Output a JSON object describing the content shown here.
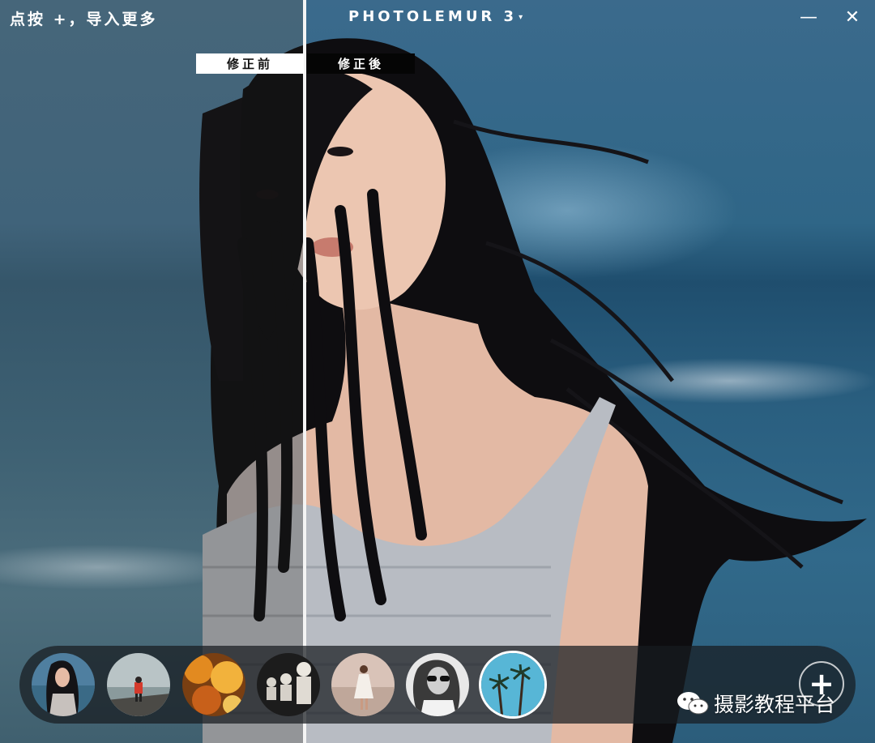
{
  "window": {
    "title": "PHOTOLEMUR 3",
    "title_caret": "▾",
    "import_hint": "点按 +，导入更多",
    "minimize_glyph": "—",
    "close_glyph": "✕"
  },
  "compare": {
    "before_label": "修正前",
    "after_label": "修正後",
    "split_position": 0.348
  },
  "thumbnails": [
    {
      "name": "woman-beach-portrait",
      "selected": false
    },
    {
      "name": "person-red-jacket-dock",
      "selected": false
    },
    {
      "name": "autumn-leaves",
      "selected": false
    },
    {
      "name": "statues",
      "selected": false
    },
    {
      "name": "woman-dancing-beach",
      "selected": false
    },
    {
      "name": "woman-sunglasses-bw",
      "selected": false
    },
    {
      "name": "palm-trees-sky",
      "selected": true
    }
  ],
  "add_button": {
    "label": "+"
  },
  "watermark": {
    "text": "摄影教程平台",
    "icon": "wechat-icon"
  },
  "colors": {
    "divider": "#f4f4f4",
    "label_before_bg": "#ffffff",
    "label_after_bg": "#050505"
  }
}
